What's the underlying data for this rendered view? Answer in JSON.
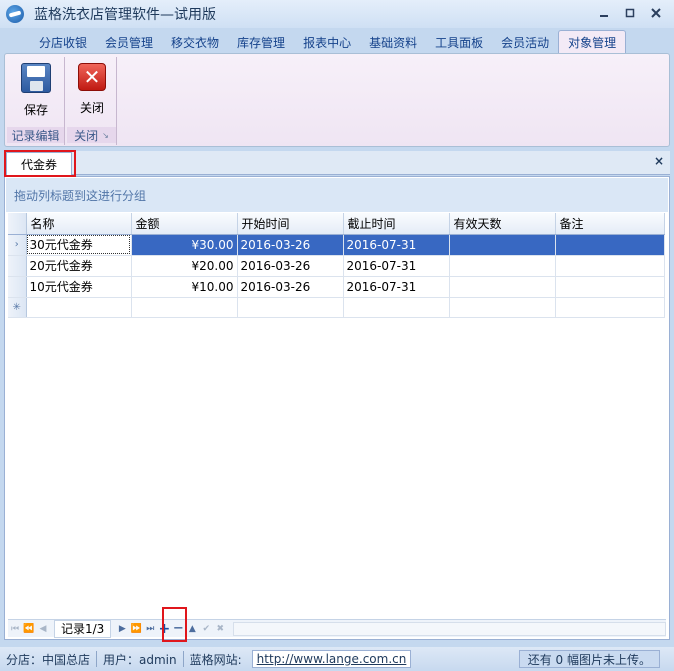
{
  "window": {
    "title": "蓝格洗衣店管理软件—试用版",
    "controls": [
      "minimize-icon",
      "restore-icon",
      "close-icon"
    ]
  },
  "ribbon": {
    "tabs": [
      "分店收银",
      "会员管理",
      "移交衣物",
      "库存管理",
      "报表中心",
      "基础资料",
      "工具面板",
      "会员活动",
      "对象管理"
    ],
    "active_tab": "对象管理",
    "groups": {
      "edit": {
        "title": "记录编辑",
        "button": "保存",
        "icon": "save-disk-icon"
      },
      "close": {
        "title": "关闭",
        "button": "关闭",
        "icon": "close-x-icon"
      }
    }
  },
  "document": {
    "tab": "代金券",
    "close_glyph": "×"
  },
  "grid": {
    "group_hint": "拖动列标题到这进行分组",
    "columns": [
      "名称",
      "金额",
      "开始时间",
      "截止时间",
      "有效天数",
      "备注"
    ],
    "rows": [
      {
        "name": "30元代金券",
        "amount": "¥30.00",
        "start": "2016-03-26",
        "end": "2016-07-31",
        "days": "",
        "note": ""
      },
      {
        "name": "20元代金券",
        "amount": "¥20.00",
        "start": "2016-03-26",
        "end": "2016-07-31",
        "days": "",
        "note": ""
      },
      {
        "name": "10元代金券",
        "amount": "¥10.00",
        "start": "2016-03-26",
        "end": "2016-07-31",
        "days": "",
        "note": ""
      }
    ],
    "selected_row": 0
  },
  "navigator": {
    "record_text": "记录1/3",
    "buttons": [
      "first",
      "prev-page",
      "prev",
      "next",
      "next-page",
      "last",
      "add",
      "delete",
      "edit",
      "post",
      "cancel"
    ]
  },
  "statusbar": {
    "branch": "分店：中国总店",
    "user": "用户：admin",
    "site_label": "蓝格网站:",
    "site_url": "http://www.lange.com.cn",
    "upload": "还有 0 幅图片未上传。"
  },
  "colors": {
    "highlight": "#e0161c",
    "selection": "#3868c2"
  }
}
